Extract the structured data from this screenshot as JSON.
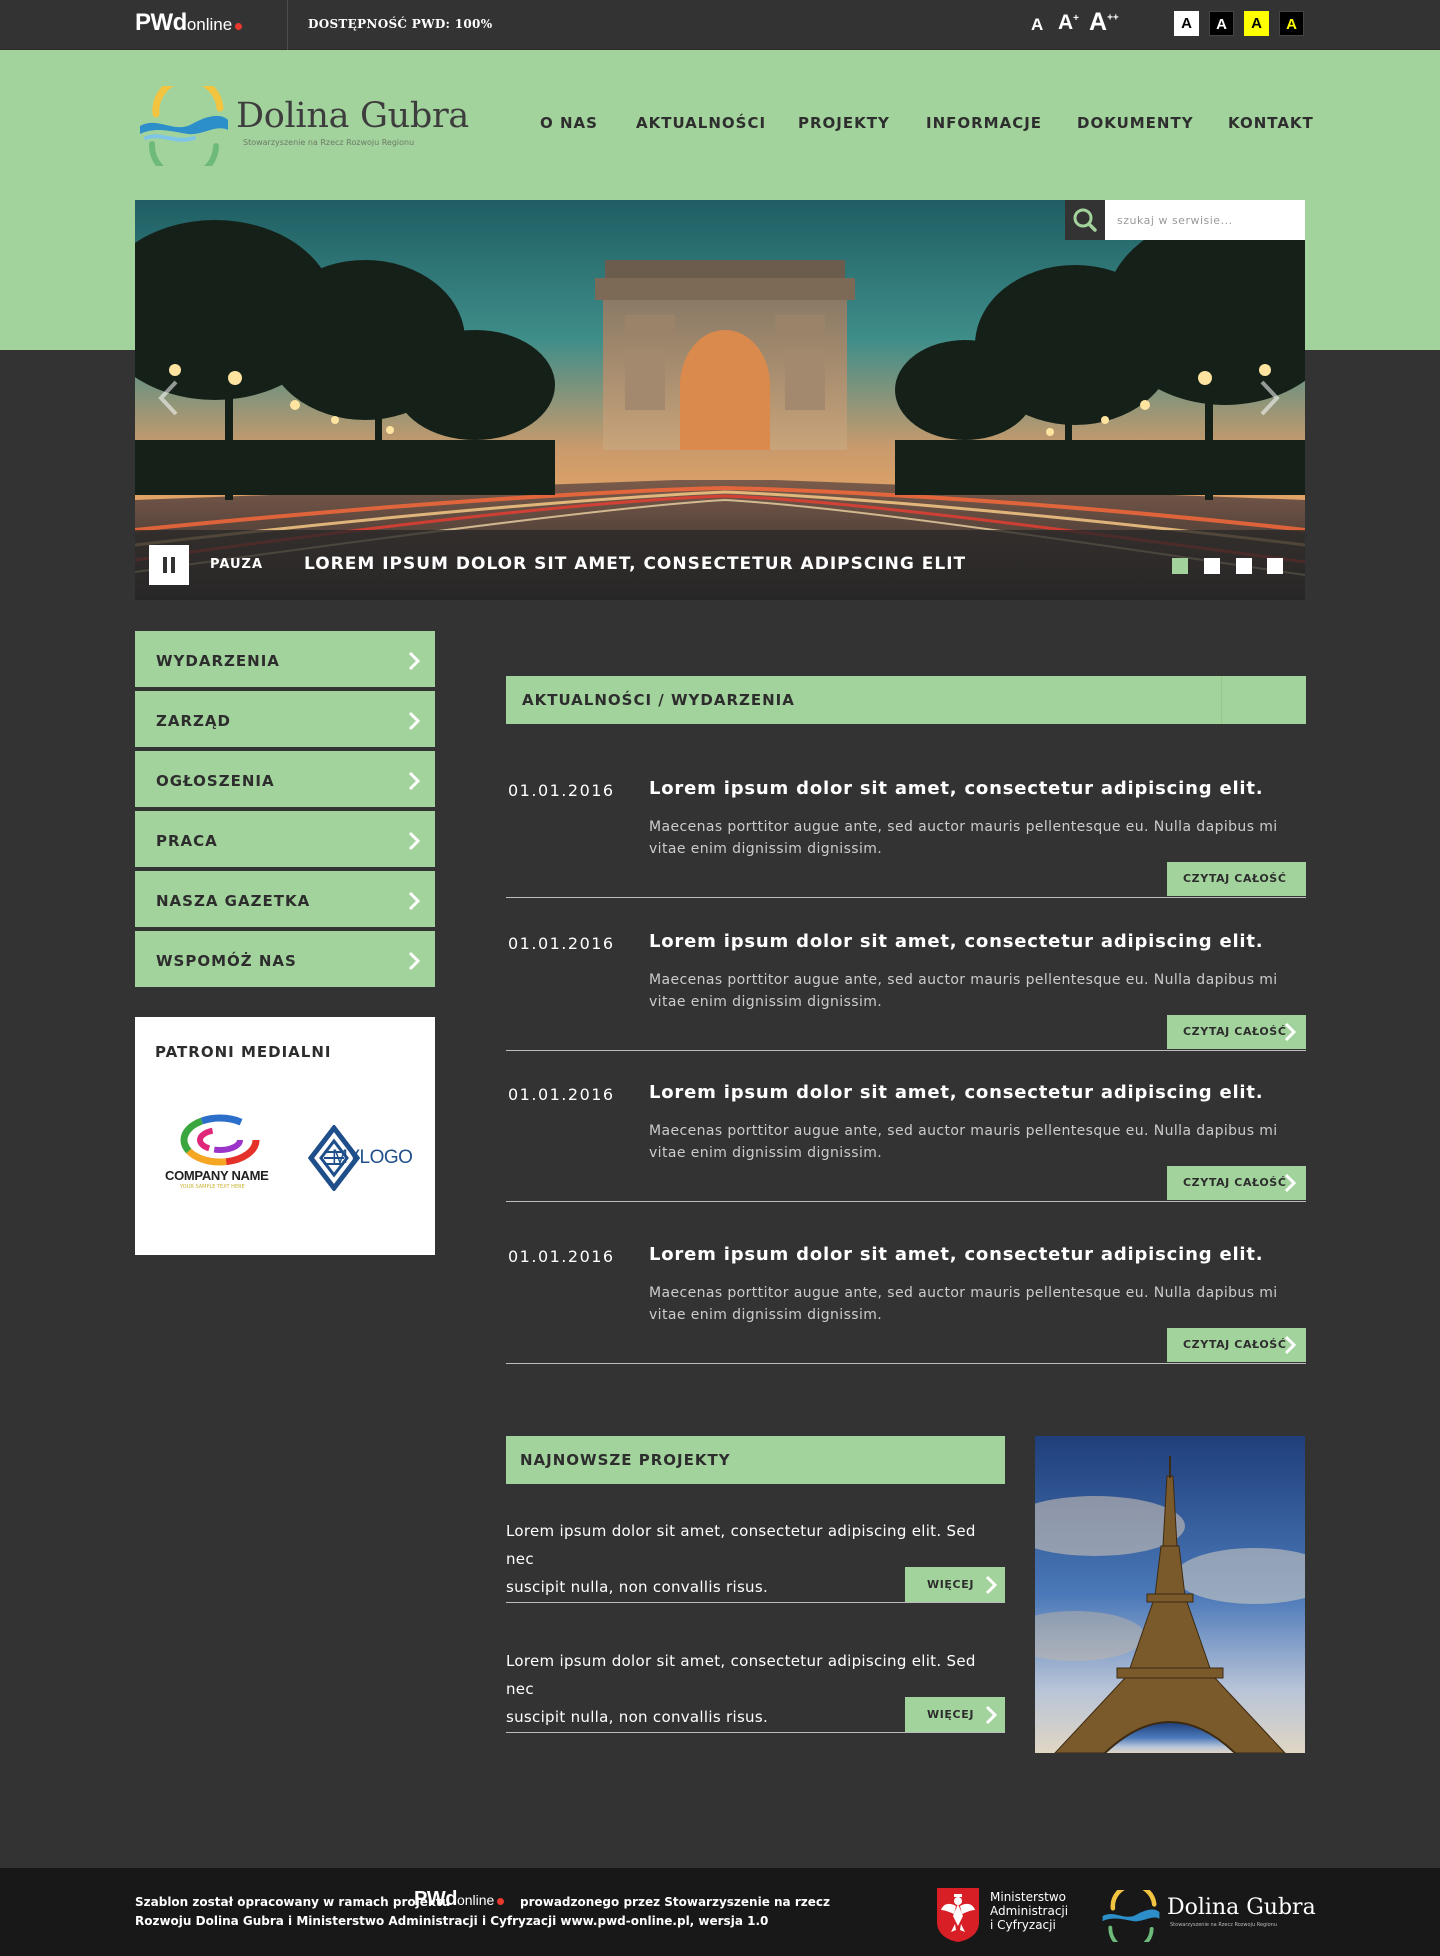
{
  "topbar": {
    "brand_big": "PWd",
    "brand_small": "online",
    "accessibility": "DOSTĘPNOŚĆ PWD: 100%",
    "font_sizes": [
      "A",
      "A",
      "A"
    ],
    "font_size_sups": [
      "",
      "+",
      "++"
    ],
    "contrast_options": [
      {
        "label": "A",
        "bg": "#ffffff",
        "fg": "#000000"
      },
      {
        "label": "A",
        "bg": "#000000",
        "fg": "#ffffff"
      },
      {
        "label": "A",
        "bg": "#ffff00",
        "fg": "#000000"
      },
      {
        "label": "A",
        "bg": "#000000",
        "fg": "#ffff00"
      }
    ]
  },
  "header": {
    "logo_title": "Dolina Gubra",
    "logo_subtitle": "Stowarzyszenie na Rzecz Rozwoju Regionu",
    "nav": [
      "O NAS",
      "AKTUALNOŚCI",
      "PROJEKTY",
      "INFORMACJE",
      "DOKUMENTY",
      "KONTAKT"
    ]
  },
  "search": {
    "placeholder": "szukaj w serwisie..."
  },
  "slider": {
    "pause_label": "PAUZA",
    "caption": "LOREM IPSUM DOLOR SIT AMET, CONSECTETUR ADIPSCING ELIT",
    "dot_count": 4,
    "active_dot": 0
  },
  "sidebar": {
    "items": [
      "WYDARZENIA",
      "ZARZĄD",
      "OGŁOSZENIA",
      "PRACA",
      "NASZA GAZETKA",
      "WSPOMÓŻ NAS"
    ],
    "patrons_title": "PATRONI MEDIALNI",
    "patron1_name": "COMPANY NAME",
    "patron1_tagline": "YOUR SAMPLE TEXT HERE",
    "patron2_name": "MYLOGO"
  },
  "news": {
    "section_title": "AKTUALNOŚCI / WYDARZENIA",
    "read_more_label": "CZYTAJ CAŁOŚĆ",
    "items": [
      {
        "date": "01.01.2016",
        "title": "Lorem ipsum dolor sit amet, consectetur adipiscing elit.",
        "body_line1": "Maecenas porttitor augue ante, sed auctor mauris pellentesque eu. Nulla dapibus mi",
        "body_line2": "vitae enim dignissim dignissim."
      },
      {
        "date": "01.01.2016",
        "title": "Lorem ipsum dolor sit amet, consectetur adipiscing elit.",
        "body_line1": "Maecenas porttitor augue ante, sed auctor mauris pellentesque eu. Nulla dapibus mi",
        "body_line2": "vitae enim dignissim dignissim."
      },
      {
        "date": "01.01.2016",
        "title": "Lorem ipsum dolor sit amet, consectetur adipiscing elit.",
        "body_line1": "Maecenas porttitor augue ante, sed auctor mauris pellentesque eu. Nulla dapibus mi",
        "body_line2": "vitae enim dignissim dignissim."
      },
      {
        "date": "01.01.2016",
        "title": "Lorem ipsum dolor sit amet, consectetur adipiscing elit.",
        "body_line1": "Maecenas porttitor augue ante, sed auctor mauris pellentesque eu. Nulla dapibus mi",
        "body_line2": "vitae enim dignissim dignissim."
      }
    ]
  },
  "projects": {
    "section_title": "NAJNOWSZE PROJEKTY",
    "more_label": "WIĘCEJ",
    "items": [
      {
        "line1": "Lorem ipsum dolor sit amet, consectetur adipiscing elit. Sed nec",
        "line2": "suscipit nulla, non convallis risus."
      },
      {
        "line1": "Lorem ipsum dolor sit amet, consectetur adipiscing elit. Sed nec",
        "line2": "suscipit nulla, non convallis risus."
      }
    ]
  },
  "footer": {
    "text1": "Szablon został opracowany w ramach projektu",
    "brand_big": "PWd",
    "brand_small": "online",
    "text2": "prowadzonego przez Stowarzyszenie na rzecz",
    "text3": "Rozwoju Dolina Gubra i Ministerstwo Administracji i Cyfryzacji www.pwd-online.pl, wersja 1.0",
    "ministry_line1": "Ministerstwo",
    "ministry_line2": "Administracji",
    "ministry_line3": "i Cyfryzacji",
    "logo_title": "Dolina Gubra",
    "logo_subtitle": "Stowarzyszenie na Rzecz Rozwoju Regionu"
  },
  "colors": {
    "accent_green": "#a3d39c",
    "dark_bg": "#333333",
    "footer_bg": "#181818",
    "pwd_dot": "#e8392f"
  },
  "icons": [
    "search-icon",
    "pause-icon",
    "chevron-left-icon",
    "chevron-right-icon",
    "eagle-emblem-icon"
  ]
}
